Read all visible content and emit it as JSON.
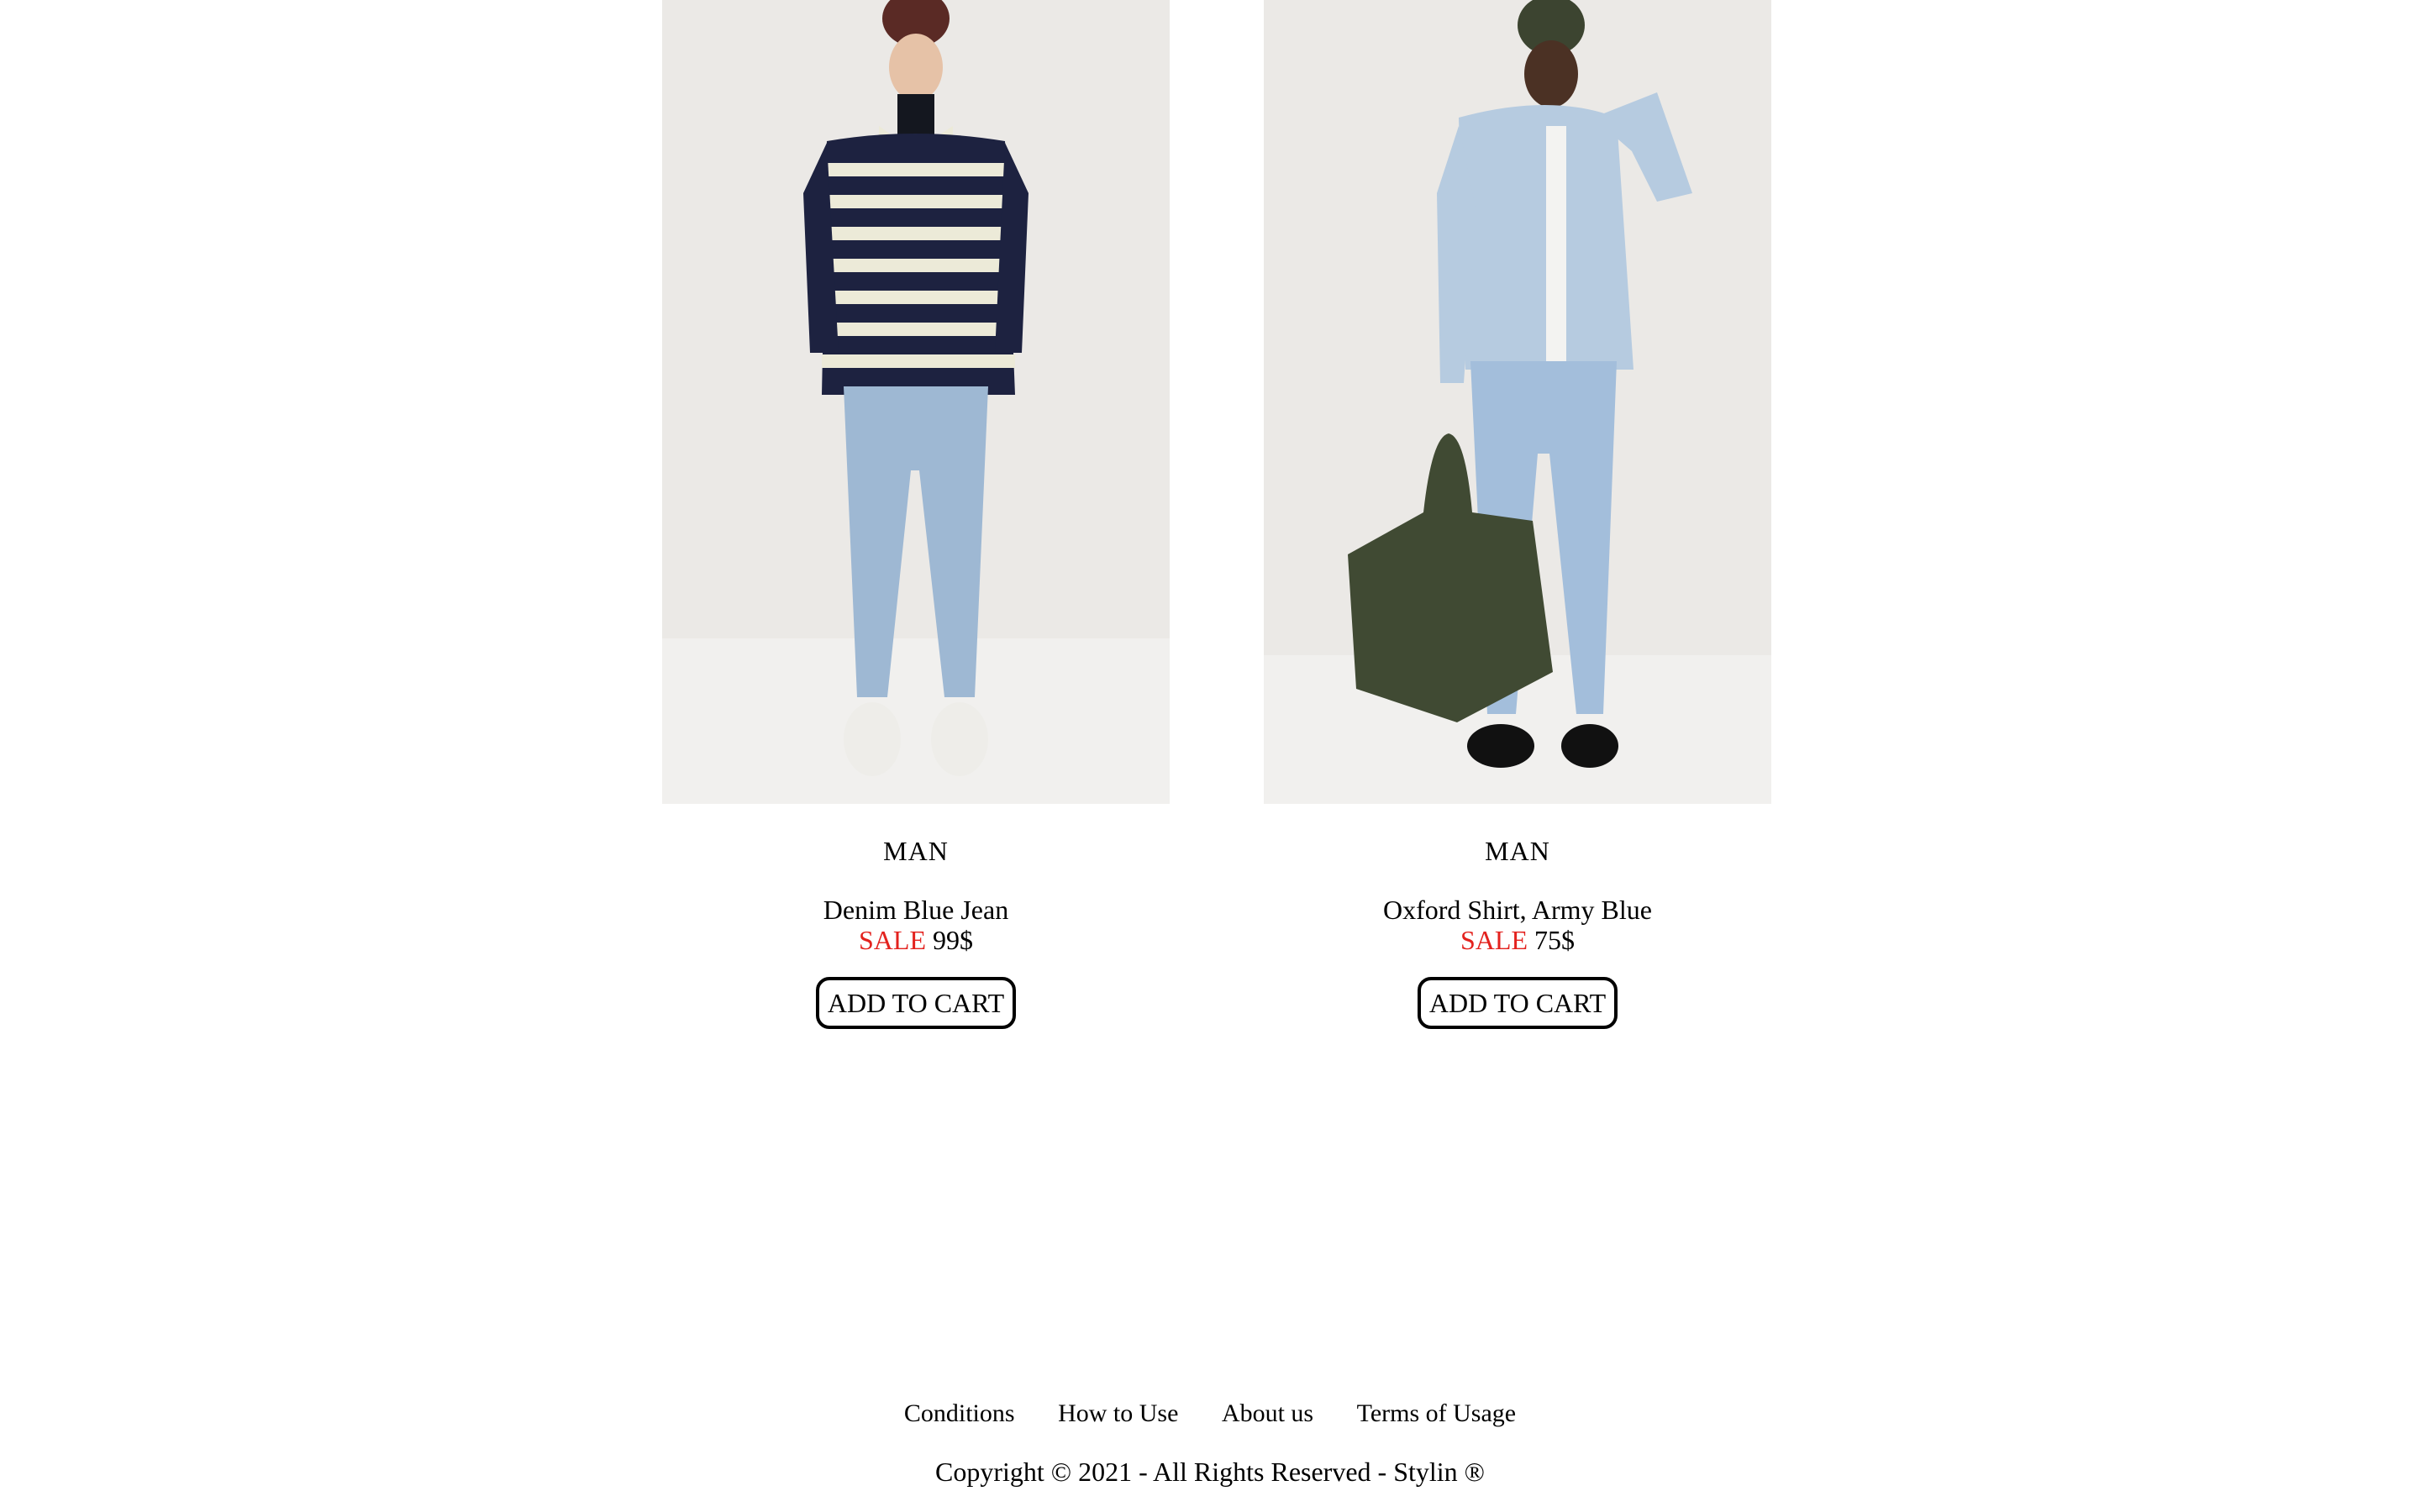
{
  "products": [
    {
      "image_alt": "Man in striped polo and light denim jeans",
      "category": "MAN",
      "name": "Denim Blue Jean",
      "sale_label": "SALE",
      "price": "99$",
      "button_label": "ADD TO CART"
    },
    {
      "image_alt": "Man in light blue oxford shirt holding army green bag",
      "category": "MAN",
      "name": "Oxford Shirt, Army Blue",
      "sale_label": "SALE",
      "price": "75$",
      "button_label": "ADD TO CART"
    }
  ],
  "footer": {
    "links": [
      "Conditions",
      "How to Use",
      "About us",
      "Terms of Usage"
    ],
    "copyright": "Copyright © 2021 - All Rights Reserved - Stylin ®"
  },
  "colors": {
    "sale": "#e3221e",
    "photo_bg": "#ebe9e6"
  }
}
